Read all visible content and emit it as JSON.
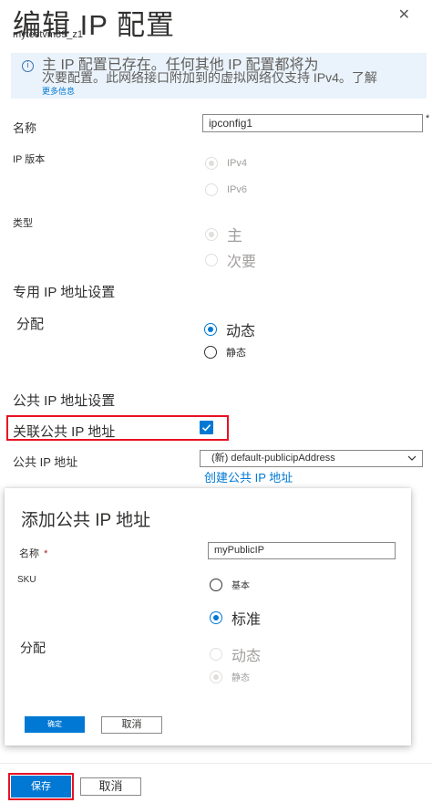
{
  "header": {
    "title": "编辑 IP 配置",
    "subtitle": "mytestvm89_z1",
    "close_glyph": "✕"
  },
  "info_banner": {
    "icon": "info-icon",
    "line1": "主 IP 配置已存在。任何其他 IP 配置都将为",
    "line2": "次要配置。此网络接口附加到的虚拟网络仅支持 IPv4。了解",
    "link": "更多信息"
  },
  "form": {
    "name_label": "名称",
    "name_value": "ipconfig1",
    "required_mark": "*",
    "ip_version_label": "IP 版本",
    "ip_version_options": [
      "IPv4",
      "IPv6"
    ],
    "type_label": "类型",
    "type_options": [
      "主",
      "次要"
    ],
    "private_section": "专用 IP 地址设置",
    "assignment_label": "分配",
    "assignment_options": [
      "动态",
      "静态"
    ],
    "public_section": "公共 IP 地址设置",
    "associate_label": "关联公共 IP 地址",
    "associate_checked": true,
    "public_ip_label": "公共 IP 地址",
    "public_ip_value": "(新) default-publicipAddress",
    "create_link": "创建公共 IP 地址"
  },
  "add_public_ip": {
    "title": "添加公共 IP 地址",
    "name_label": "名称",
    "required_mark": "*",
    "name_value": "myPublicIP",
    "sku_label": "SKU",
    "sku_options": [
      "基本",
      "标准"
    ],
    "assignment_label": "分配",
    "assignment_options": [
      "动态",
      "静态"
    ],
    "ok_label": "确定",
    "cancel_label": "取消"
  },
  "footer": {
    "save_label": "保存",
    "cancel_label": "取消"
  },
  "colors": {
    "accent": "#0078d4",
    "highlight": "#e81123",
    "banner_bg": "#eaf3fb"
  }
}
